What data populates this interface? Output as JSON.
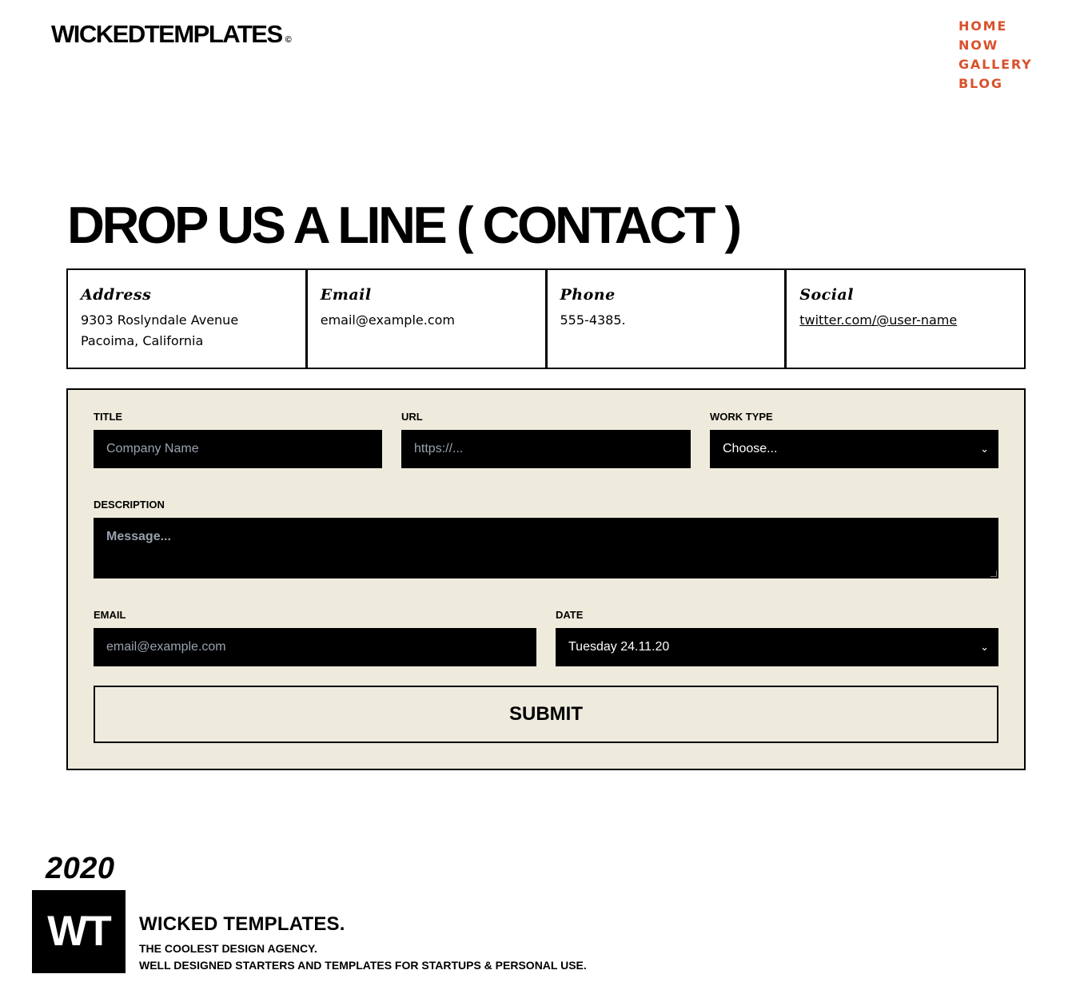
{
  "header": {
    "brand": "WICKEDTEMPLATES",
    "brand_mark": "©",
    "nav": [
      "HOME",
      "NOW",
      "GALLERY",
      "BLOG"
    ],
    "nav_color": "#d9512c"
  },
  "headline": "DROP US A LINE ( CONTACT )",
  "contact": {
    "address": {
      "title": "Address",
      "line1": "9303 Roslyndale Avenue",
      "line2": "Pacoima, California"
    },
    "email": {
      "title": "Email",
      "value": "email@example.com"
    },
    "phone": {
      "title": "Phone",
      "value": "555-4385."
    },
    "social": {
      "title": "Social",
      "value": "twitter.com/@user-name"
    }
  },
  "form": {
    "background": "#eeebdd",
    "title_label": "TITLE",
    "title_placeholder": "Company Name",
    "url_label": "URL",
    "url_placeholder": "https://...",
    "worktype_label": "WORK TYPE",
    "worktype_value": "Choose...",
    "description_label": "DESCRIPTION",
    "description_placeholder": "Message...",
    "email_label": "EMAIL",
    "email_placeholder": "email@example.com",
    "date_label": "DATE",
    "date_value": "Tuesday 24.11.20",
    "submit_label": "SUBMIT"
  },
  "footer": {
    "year": "2020",
    "logo": "WT",
    "company": "WICKED TEMPLATES.",
    "tagline1": "THE COOLEST DESIGN AGENCY.",
    "tagline2": "WELL DESIGNED STARTERS AND TEMPLATES FOR STARTUPS & PERSONAL USE."
  }
}
